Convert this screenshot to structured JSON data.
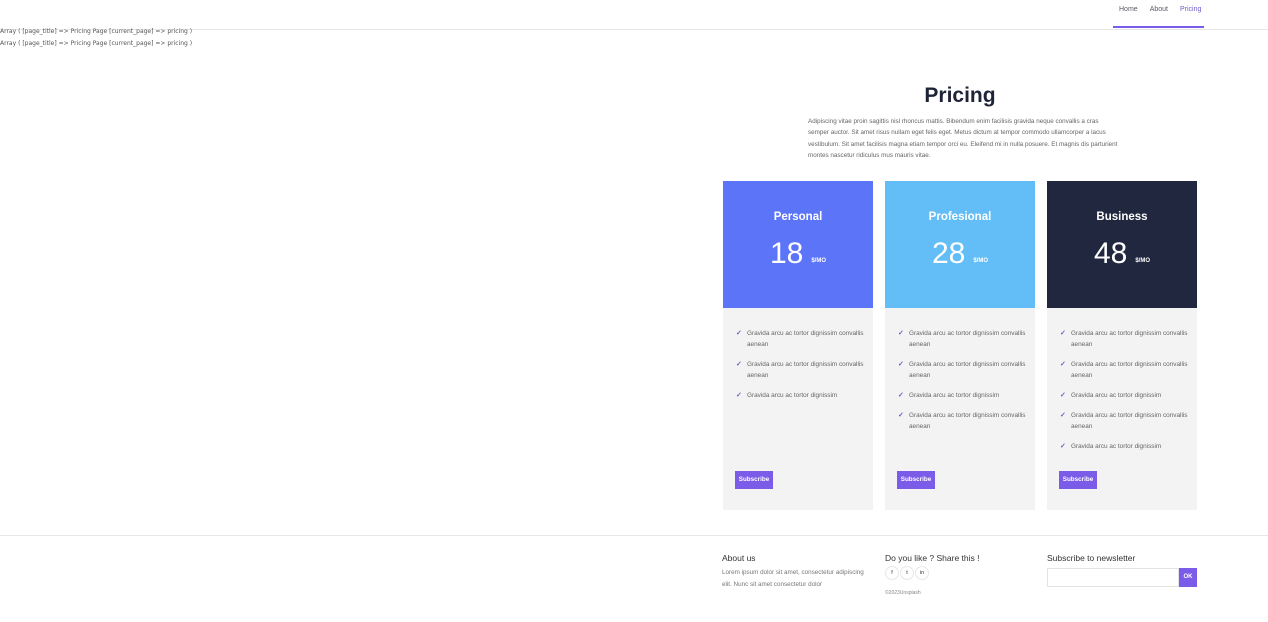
{
  "nav": {
    "items": [
      "Home",
      "About",
      "Pricing"
    ],
    "active": "Pricing"
  },
  "debug": {
    "line1": "Array ( [page_title] => Pricing Page [current_page] => pricing )",
    "line2": "Array ( [page_title] => Pricing Page [current_page] => pricing )"
  },
  "pricing": {
    "title": "Pricing",
    "intro": "Adipiscing vitae proin sagittis nisl rhoncus mattis. Bibendum enim facilisis gravida neque convallis a cras semper auctor. Sit amet risus nullam eget felis eget. Metus dictum at tempor commodo ullamcorper a lacus vestibulum. Sit amet facilisis magna etiam tempor orci eu. Eleifend mi in nulla posuere. Et magnis dis parturient montes nascetur ridiculus mus mauris vitae.",
    "plans": [
      {
        "name": "Personal",
        "price": "18",
        "unit": "$/MO",
        "color": "#5b74f8",
        "features": [
          "Gravida arcu ac tortor dignissim convallis aenean",
          "Gravida arcu ac tortor dignissim convallis aenean",
          "Gravida arcu ac tortor dignissim"
        ],
        "button": "Subscribe"
      },
      {
        "name": "Profesional",
        "price": "28",
        "unit": "$/MO",
        "color": "#63bdf6",
        "features": [
          "Gravida arcu ac tortor dignissim convallis aenean",
          "Gravida arcu ac tortor dignissim convallis aenean",
          "Gravida arcu ac tortor dignissim",
          "Gravida arcu ac tortor dignissim convallis aenean"
        ],
        "button": "Subscribe"
      },
      {
        "name": "Business",
        "price": "48",
        "unit": "$/MO",
        "color": "#21273f",
        "features": [
          "Gravida arcu ac tortor dignissim convallis aenean",
          "Gravida arcu ac tortor dignissim convallis aenean",
          "Gravida arcu ac tortor dignissim",
          "Gravida arcu ac tortor dignissim convallis aenean",
          "Gravida arcu ac tortor dignissim"
        ],
        "button": "Subscribe"
      }
    ]
  },
  "footer": {
    "about_title": "About us",
    "about_text": "Lorem ipsum dolor sit amet, consectetur adipiscing elit. Nunc sit amet consectetur dolor",
    "share_title": "Do you like ? Share this !",
    "social": [
      "f",
      "t",
      "in"
    ],
    "copyright": "©2023Unsplash",
    "newsletter_title": "Subscribe to newsletter",
    "newsletter_button": "OK",
    "accent": "#7b5ce8"
  }
}
